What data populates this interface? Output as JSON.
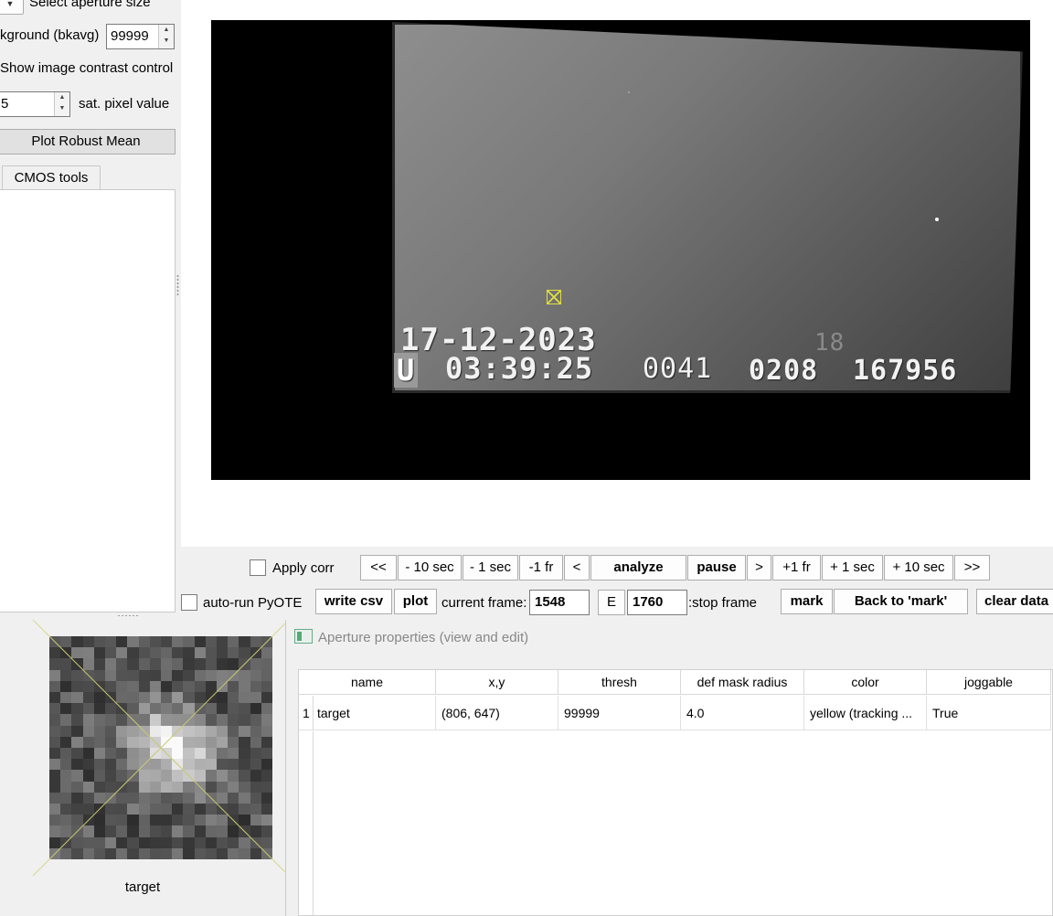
{
  "left_panel": {
    "aperture_dropdown_label": "Select aperture size",
    "background_label": "kground (bkavg)",
    "background_value": "99999",
    "contrast_label": "Show image contrast control",
    "sat_value": "5",
    "sat_label": "sat. pixel value",
    "plot_robust_mean_label": "Plot Robust Mean",
    "tab_label": "CMOS tools"
  },
  "video": {
    "date_text": "17-12-2023",
    "time_text": "03:39:25",
    "counter_a": "0041",
    "counter_b": "0208",
    "counter_c": "167956",
    "faint_number": "18",
    "edge_char": "U"
  },
  "controls": {
    "apply_corr_label": "Apply corr",
    "nav_buttons": [
      "<<",
      "- 10 sec",
      "- 1 sec",
      "-1 fr",
      "<",
      "analyze",
      "pause",
      ">",
      "+1 fr",
      "+ 1 sec",
      "+ 10 sec",
      ">>"
    ],
    "auto_run_label": "auto-run PyOTE",
    "write_csv_label": "write csv",
    "plot_label": "plot",
    "current_frame_label": "current frame:",
    "current_frame_value": "1548",
    "e_label": "E",
    "stop_frame_value": "1760",
    "stop_frame_label": ":stop frame",
    "mark_label": "mark",
    "back_to_mark_label": "Back to 'mark'",
    "clear_data_label": "clear data"
  },
  "thumbnail": {
    "caption": "target"
  },
  "aperture_properties": {
    "title": "Aperture properties (view and edit)",
    "columns": [
      "name",
      "x,y",
      "thresh",
      "def mask radius",
      "color",
      "joggable"
    ],
    "rows": [
      {
        "index": "1",
        "name": "target",
        "xy": "(806, 647)",
        "thresh": "99999",
        "radius": "4.0",
        "color": "yellow (tracking ...",
        "joggable": "True"
      }
    ]
  },
  "colors": {
    "marker": "#e0e040",
    "window_bg": "#f0f0f0"
  }
}
